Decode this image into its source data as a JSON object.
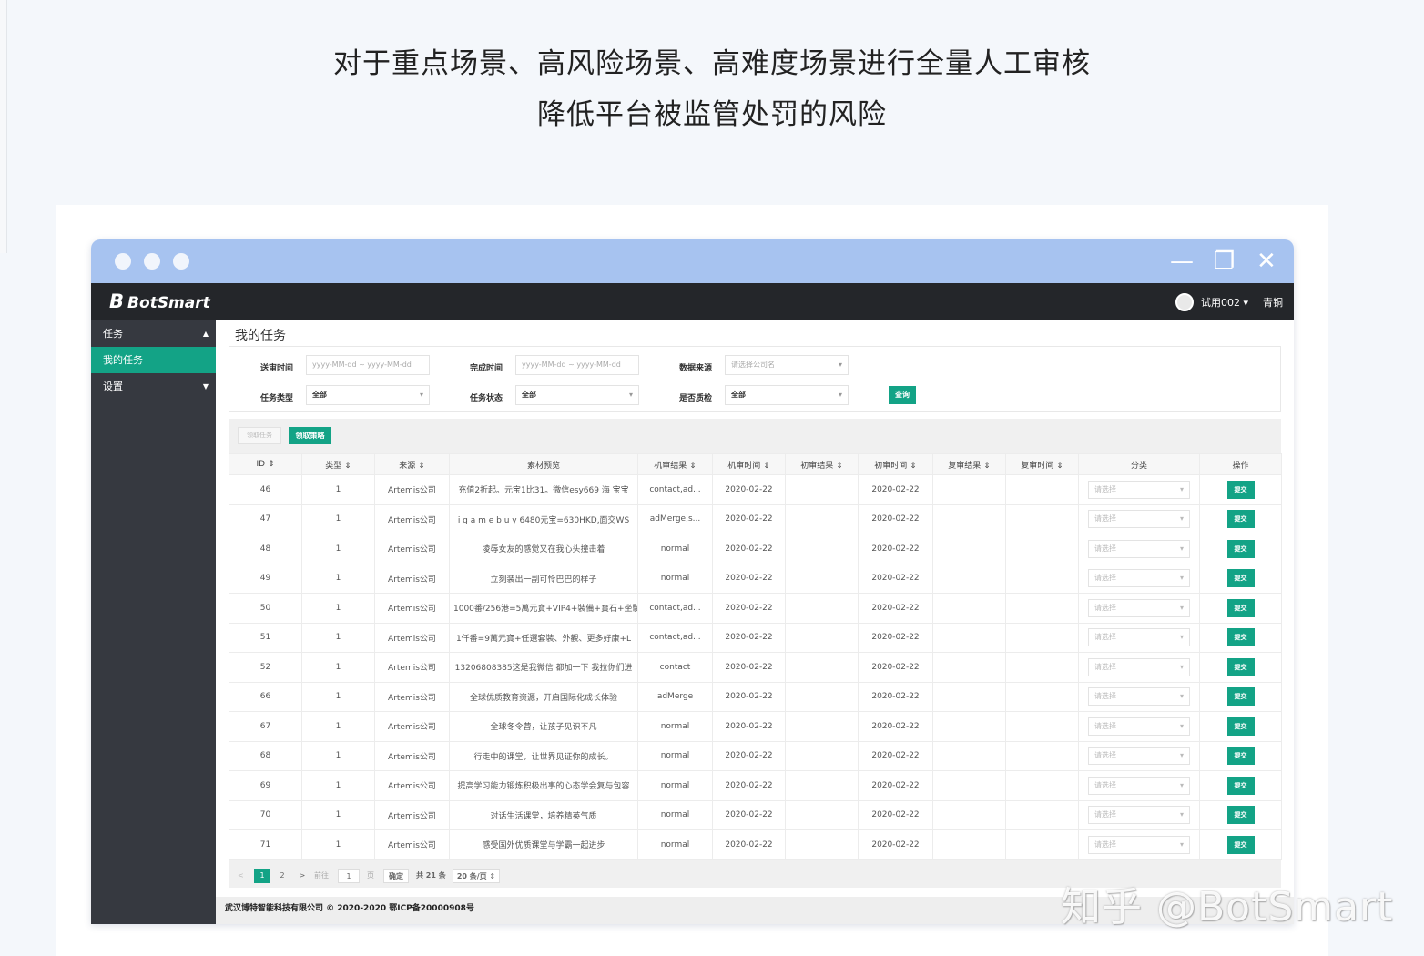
{
  "headline": {
    "line1": "对于重点场景、高风险场景、高难度场景进行全量人工审核",
    "line2": "降低平台被监管处罚的风险"
  },
  "window_controls": {
    "minimize": "—",
    "restore": "❐",
    "close": "✕"
  },
  "app": {
    "logo_mark": "B",
    "logo_text": "BotSmart",
    "user_name": "试用002 ▾",
    "logout": "青铜"
  },
  "sidebar": {
    "items": [
      {
        "label": "任务",
        "arrow": "▲"
      },
      {
        "label": "我的任务",
        "arrow": ""
      },
      {
        "label": "设置",
        "arrow": "▼"
      }
    ]
  },
  "page_title": "我的任务",
  "filters": {
    "send_time_label": "送审时间",
    "send_time_placeholder": "yyyy-MM-dd ~ yyyy-MM-dd",
    "done_time_label": "完成时间",
    "done_time_placeholder": "yyyy-MM-dd ~ yyyy-MM-dd",
    "source_label": "数据来源",
    "source_placeholder": "请选择公司名",
    "type_label": "任务类型",
    "type_value": "全部",
    "status_label": "任务状态",
    "status_value": "全部",
    "qualified_label": "是否质检",
    "qualified_value": "全部",
    "query_button": "查询"
  },
  "toolbar": {
    "release_button": "领取任务",
    "claim_button": "领取策略"
  },
  "table": {
    "columns": [
      "ID ⇕",
      "类型 ⇕",
      "来源 ⇕",
      "素材预览",
      "机审结果 ⇕",
      "机审时间 ⇕",
      "初审结果 ⇕",
      "初审时间 ⇕",
      "复审结果 ⇕",
      "复审时间 ⇕",
      "分类",
      "操作"
    ],
    "select_placeholder": "请选择",
    "submit_label": "提交",
    "rows": [
      {
        "id": "46",
        "type": "1",
        "source": "Artemis公司",
        "preview": "充值2折起。元宝1比31。微信esy669 海 宝宝",
        "machine": "contact,ad...",
        "machine_time": "2020-02-22",
        "first": "",
        "first_time": "2020-02-22",
        "second": "",
        "second_time": ""
      },
      {
        "id": "47",
        "type": "1",
        "source": "Artemis公司",
        "preview": "i g a m e b u y 6480元宝=630HKD,面交WS",
        "machine": "adMerge,s...",
        "machine_time": "2020-02-22",
        "first": "",
        "first_time": "2020-02-22",
        "second": "",
        "second_time": ""
      },
      {
        "id": "48",
        "type": "1",
        "source": "Artemis公司",
        "preview": "凌辱女友的感觉又在我心头撞击着",
        "machine": "normal",
        "machine_time": "2020-02-22",
        "first": "",
        "first_time": "2020-02-22",
        "second": "",
        "second_time": ""
      },
      {
        "id": "49",
        "type": "1",
        "source": "Artemis公司",
        "preview": "立刻装出一副可怜巴巴的样子",
        "machine": "normal",
        "machine_time": "2020-02-22",
        "first": "",
        "first_time": "2020-02-22",
        "second": "",
        "second_time": ""
      },
      {
        "id": "50",
        "type": "1",
        "source": "Artemis公司",
        "preview": "1000番/256港=5萬元寶+VIP4+裝備+寶石+坐騎",
        "machine": "contact,ad...",
        "machine_time": "2020-02-22",
        "first": "",
        "first_time": "2020-02-22",
        "second": "",
        "second_time": ""
      },
      {
        "id": "51",
        "type": "1",
        "source": "Artemis公司",
        "preview": "1仟番=9萬元寶+任選套裝、外觀、更多好康+L",
        "machine": "contact,ad...",
        "machine_time": "2020-02-22",
        "first": "",
        "first_time": "2020-02-22",
        "second": "",
        "second_time": ""
      },
      {
        "id": "52",
        "type": "1",
        "source": "Artemis公司",
        "preview": "13206808385这是我微信 都加一下 我拉你们进",
        "machine": "contact",
        "machine_time": "2020-02-22",
        "first": "",
        "first_time": "2020-02-22",
        "second": "",
        "second_time": ""
      },
      {
        "id": "66",
        "type": "1",
        "source": "Artemis公司",
        "preview": "全球优质教育资源，开启国际化成长体验",
        "machine": "adMerge",
        "machine_time": "2020-02-22",
        "first": "",
        "first_time": "2020-02-22",
        "second": "",
        "second_time": ""
      },
      {
        "id": "67",
        "type": "1",
        "source": "Artemis公司",
        "preview": "全球冬令营，让孩子见识不凡",
        "machine": "normal",
        "machine_time": "2020-02-22",
        "first": "",
        "first_time": "2020-02-22",
        "second": "",
        "second_time": ""
      },
      {
        "id": "68",
        "type": "1",
        "source": "Artemis公司",
        "preview": "行走中的课堂，让世界见证你的成长。",
        "machine": "normal",
        "machine_time": "2020-02-22",
        "first": "",
        "first_time": "2020-02-22",
        "second": "",
        "second_time": ""
      },
      {
        "id": "69",
        "type": "1",
        "source": "Artemis公司",
        "preview": "提高学习能力锻炼积极出事的心态学会复与包容",
        "machine": "normal",
        "machine_time": "2020-02-22",
        "first": "",
        "first_time": "2020-02-22",
        "second": "",
        "second_time": ""
      },
      {
        "id": "70",
        "type": "1",
        "source": "Artemis公司",
        "preview": "对话生活课堂，培养精英气质",
        "machine": "normal",
        "machine_time": "2020-02-22",
        "first": "",
        "first_time": "2020-02-22",
        "second": "",
        "second_time": ""
      },
      {
        "id": "71",
        "type": "1",
        "source": "Artemis公司",
        "preview": "感受国外优质课堂与学霸一起进步",
        "machine": "normal",
        "machine_time": "2020-02-22",
        "first": "",
        "first_time": "2020-02-22",
        "second": "",
        "second_time": ""
      }
    ]
  },
  "pagination": {
    "prev": "<",
    "page1": "1",
    "page2": "2",
    "next": ">",
    "goto_label": "前往",
    "goto_value": "1",
    "page_unit": "页",
    "confirm": "确定",
    "total": "共 21 条",
    "page_size": "20 条/页 ⇕"
  },
  "footer": "武汉博特智能科技有限公司 © 2020-2020 鄂ICP备20000908号",
  "watermark": "知乎 @BotSmart",
  "colors": {
    "accent": "#13a386",
    "titlebar": "#a7c3f0",
    "appbar": "#24262a",
    "sidebar": "#363940"
  }
}
